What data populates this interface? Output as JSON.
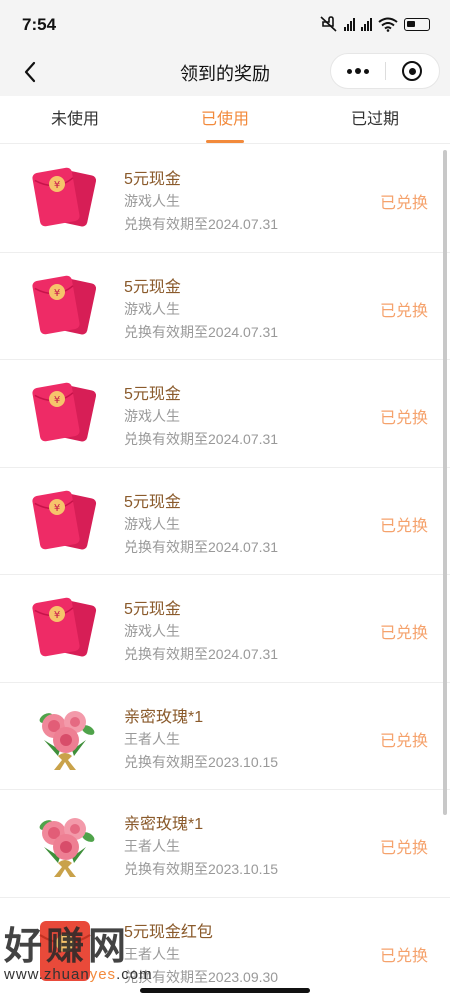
{
  "status": {
    "time": "7:54"
  },
  "nav": {
    "title": "领到的奖励"
  },
  "tabs": [
    {
      "label": "未使用",
      "active": false
    },
    {
      "label": "已使用",
      "active": true
    },
    {
      "label": "已过期",
      "active": false
    }
  ],
  "items": [
    {
      "title": "5元现金",
      "source": "游戏人生",
      "expiry": "兑换有效期至2024.07.31",
      "status": "已兑换",
      "icon": "red-envelope-icon"
    },
    {
      "title": "5元现金",
      "source": "游戏人生",
      "expiry": "兑换有效期至2024.07.31",
      "status": "已兑换",
      "icon": "red-envelope-icon"
    },
    {
      "title": "5元现金",
      "source": "游戏人生",
      "expiry": "兑换有效期至2024.07.31",
      "status": "已兑换",
      "icon": "red-envelope-icon"
    },
    {
      "title": "5元现金",
      "source": "游戏人生",
      "expiry": "兑换有效期至2024.07.31",
      "status": "已兑换",
      "icon": "red-envelope-icon"
    },
    {
      "title": "5元现金",
      "source": "游戏人生",
      "expiry": "兑换有效期至2024.07.31",
      "status": "已兑换",
      "icon": "red-envelope-icon"
    },
    {
      "title": "亲密玫瑰*1",
      "source": "王者人生",
      "expiry": "兑换有效期至2023.10.15",
      "status": "已兑换",
      "icon": "rose-bouquet-icon"
    },
    {
      "title": "亲密玫瑰*1",
      "source": "王者人生",
      "expiry": "兑换有效期至2023.10.15",
      "status": "已兑换",
      "icon": "rose-bouquet-icon"
    },
    {
      "title": "5元现金红包",
      "source": "王者人生",
      "expiry": "兑换有效期至2023.09.30",
      "status": "已兑换",
      "icon": "red-packet-icon"
    }
  ],
  "watermark": {
    "title": "好赚网",
    "url_prefix": "www.zhuan",
    "url_accent": "yes",
    "url_suffix": ".com"
  },
  "colors": {
    "accent": "#f28a3c",
    "status_text": "#f5a26c",
    "title_text": "#8a5a2b",
    "envelope": "#e8265c"
  }
}
